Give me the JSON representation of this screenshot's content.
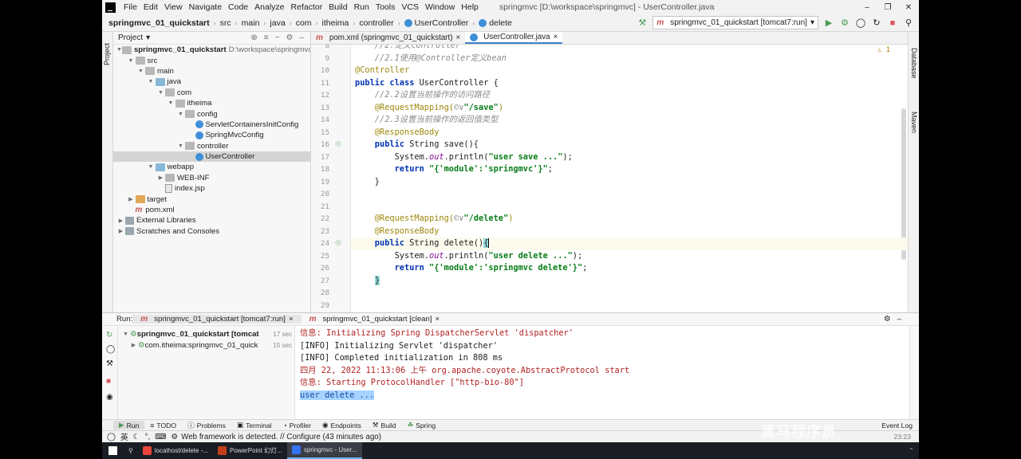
{
  "window": {
    "title": "springmvc [D:\\workspace\\springmvc] - UserController.java",
    "controls": [
      "–",
      "❐",
      "✕"
    ]
  },
  "menu": [
    "File",
    "Edit",
    "View",
    "Navigate",
    "Code",
    "Analyze",
    "Refactor",
    "Build",
    "Run",
    "Tools",
    "VCS",
    "Window",
    "Help"
  ],
  "breadcrumb": [
    "springmvc_01_quickstart",
    "src",
    "main",
    "java",
    "com",
    "itheima",
    "controller",
    "UserController",
    "delete"
  ],
  "run_config": "springmvc_01_quickstart [tomcat7:run]",
  "left_strip": [
    "Project"
  ],
  "right_strip": [
    "Database",
    "Maven"
  ],
  "project_panel": {
    "title": "Project",
    "tree": [
      {
        "label": "springmvc_01_quickstart",
        "path": "D:\\workspace\\springmvc\\s",
        "depth": 0,
        "arrow": "down",
        "icon": "folder-plain",
        "bold": true
      },
      {
        "label": "src",
        "depth": 1,
        "arrow": "down",
        "icon": "folder-plain"
      },
      {
        "label": "main",
        "depth": 2,
        "arrow": "down",
        "icon": "folder-plain"
      },
      {
        "label": "java",
        "depth": 3,
        "arrow": "down",
        "icon": "folder"
      },
      {
        "label": "com",
        "depth": 4,
        "arrow": "down",
        "icon": "folder-plain"
      },
      {
        "label": "itheima",
        "depth": 5,
        "arrow": "down",
        "icon": "folder-plain"
      },
      {
        "label": "config",
        "depth": 6,
        "arrow": "down",
        "icon": "folder-plain"
      },
      {
        "label": "ServletContainersInitConfig",
        "depth": 7,
        "arrow": "",
        "icon": "class"
      },
      {
        "label": "SpringMvcConfig",
        "depth": 7,
        "arrow": "",
        "icon": "class"
      },
      {
        "label": "controller",
        "depth": 6,
        "arrow": "down",
        "icon": "folder-plain"
      },
      {
        "label": "UserController",
        "depth": 7,
        "arrow": "",
        "icon": "class",
        "selected": true
      },
      {
        "label": "webapp",
        "depth": 3,
        "arrow": "down",
        "icon": "folder"
      },
      {
        "label": "WEB-INF",
        "depth": 4,
        "arrow": "right",
        "icon": "folder-plain"
      },
      {
        "label": "index.jsp",
        "depth": 4,
        "arrow": "",
        "icon": "file"
      },
      {
        "label": "target",
        "depth": 1,
        "arrow": "right",
        "icon": "folder-orange"
      },
      {
        "label": "pom.xml",
        "depth": 1,
        "arrow": "",
        "icon": "maven"
      },
      {
        "label": "External Libraries",
        "depth": 0,
        "arrow": "right",
        "icon": "lib"
      },
      {
        "label": "Scratches and Consoles",
        "depth": 0,
        "arrow": "right",
        "icon": "scratch"
      }
    ]
  },
  "editor": {
    "tabs": [
      {
        "label": "pom.xml (springmvc_01_quickstart)",
        "icon": "m",
        "active": false
      },
      {
        "label": "UserController.java",
        "icon": "class",
        "active": true
      }
    ],
    "warnings": "⚠ 1",
    "current_line": 23,
    "lines": [
      {
        "n": 8,
        "tokens": [
          {
            "t": "    //2.定义controller",
            "c": "cmt"
          }
        ]
      },
      {
        "n": 9,
        "tokens": [
          {
            "t": "    //2.1使用@Controller定义bean",
            "c": "cmt"
          }
        ]
      },
      {
        "n": 10,
        "tokens": [
          {
            "t": "@Controller",
            "c": "ann"
          }
        ]
      },
      {
        "n": 11,
        "tokens": [
          {
            "t": "public class ",
            "c": "kw"
          },
          {
            "t": "UserController {",
            "c": ""
          }
        ]
      },
      {
        "n": 12,
        "tokens": [
          {
            "t": "    //2.2设置当前操作的访问路径",
            "c": "cmt"
          }
        ]
      },
      {
        "n": 13,
        "tokens": [
          {
            "t": "    @RequestMapping(",
            "c": "ann"
          },
          {
            "t": "©∨",
            "c": "cmt"
          },
          {
            "t": "\"/save\"",
            "c": "str"
          },
          {
            "t": ")",
            "c": "ann"
          }
        ]
      },
      {
        "n": 14,
        "tokens": [
          {
            "t": "    //2.3设置当前操作的返回值类型",
            "c": "cmt"
          }
        ]
      },
      {
        "n": 15,
        "tokens": [
          {
            "t": "    @ResponseBody",
            "c": "ann"
          }
        ]
      },
      {
        "n": 16,
        "tokens": [
          {
            "t": "    public ",
            "c": "kw"
          },
          {
            "t": "String save(){",
            "c": ""
          }
        ]
      },
      {
        "n": 17,
        "tokens": [
          {
            "t": "        System.",
            "c": ""
          },
          {
            "t": "out",
            "c": "fld"
          },
          {
            "t": ".println(",
            "c": ""
          },
          {
            "t": "\"user save ...\"",
            "c": "str"
          },
          {
            "t": ");",
            "c": ""
          }
        ]
      },
      {
        "n": 18,
        "tokens": [
          {
            "t": "        return ",
            "c": "kw"
          },
          {
            "t": "\"{'module':'springmvc'}\"",
            "c": "str"
          },
          {
            "t": ";",
            "c": ""
          }
        ]
      },
      {
        "n": 19,
        "tokens": [
          {
            "t": "    }",
            "c": ""
          }
        ]
      },
      {
        "n": 20,
        "tokens": []
      },
      {
        "n": 21,
        "tokens": []
      },
      {
        "n": 22,
        "tokens": [
          {
            "t": "    @RequestMapping(",
            "c": "ann"
          },
          {
            "t": "©∨",
            "c": "cmt"
          },
          {
            "t": "\"/delete\"",
            "c": "str"
          },
          {
            "t": ")",
            "c": "ann"
          }
        ]
      },
      {
        "n": 23,
        "tokens": [
          {
            "t": "    @ResponseBody",
            "c": "ann"
          }
        ]
      },
      {
        "n": 24,
        "tokens": [
          {
            "t": "    public ",
            "c": "kw"
          },
          {
            "t": "String delete()",
            "c": ""
          },
          {
            "t": "{",
            "c": "brace"
          }
        ]
      },
      {
        "n": 25,
        "tokens": [
          {
            "t": "        System.",
            "c": ""
          },
          {
            "t": "out",
            "c": "fld"
          },
          {
            "t": ".println(",
            "c": ""
          },
          {
            "t": "\"user delete ...\"",
            "c": "str"
          },
          {
            "t": ");",
            "c": ""
          }
        ]
      },
      {
        "n": 26,
        "tokens": [
          {
            "t": "        return ",
            "c": "kw"
          },
          {
            "t": "\"{'module':'springmvc delete'}\"",
            "c": "str"
          },
          {
            "t": ";",
            "c": ""
          }
        ]
      },
      {
        "n": 27,
        "tokens": [
          {
            "t": "    ",
            "c": ""
          },
          {
            "t": "}",
            "c": "brace"
          }
        ]
      },
      {
        "n": 28,
        "tokens": []
      },
      {
        "n": 29,
        "tokens": []
      }
    ],
    "line_numbers": [
      8,
      9,
      10,
      11,
      12,
      13,
      14,
      15,
      16,
      17,
      18,
      19,
      20,
      21,
      22,
      23,
      24,
      25,
      26,
      27,
      28,
      29
    ]
  },
  "run_panel": {
    "label": "Run:",
    "tabs": [
      {
        "label": "springmvc_01_quickstart [tomcat7:run]",
        "active": true
      },
      {
        "label": "springmvc_01_quickstart [clean]",
        "active": false
      }
    ],
    "tree": [
      {
        "label": "springmvc_01_quickstart [tomcat",
        "duration": "17 sec",
        "bold": true
      },
      {
        "label": "com.itheima:springmvc_01_quick",
        "duration": "15 sec",
        "bold": false
      }
    ],
    "side_tabs": [
      "Structure",
      "Favorites"
    ],
    "console": [
      {
        "text": "信息: Initializing Spring DispatcherServlet 'dispatcher'",
        "red": true
      },
      {
        "text": "[INFO] Initializing Servlet 'dispatcher'",
        "red": false
      },
      {
        "text": "[INFO] Completed initialization in 808 ms",
        "red": false
      },
      {
        "text": "四月 22, 2022 11:13:06 上午 org.apache.coyote.AbstractProtocol start",
        "red": true
      },
      {
        "text": "信息: Starting ProtocolHandler [\"http-bio-80\"]",
        "red": true
      },
      {
        "text": "user delete ...",
        "red": false,
        "selected": true
      }
    ]
  },
  "tool_tabs": [
    "Run",
    "TODO",
    "Problems",
    "Terminal",
    "Profiler",
    "Endpoints",
    "Build",
    "Spring"
  ],
  "event_log": "Event Log",
  "status": {
    "ime": "英",
    "message": "Web framework is detected. // Configure (43 minutes ago)",
    "time": "23:23"
  },
  "taskbar": [
    {
      "label": "localhost/delete -...",
      "color": "#e8453c",
      "active": false
    },
    {
      "label": "PowerPoint 幻灯...",
      "color": "#c43e1c",
      "active": false
    },
    {
      "label": "springmvc - User...",
      "color": "#3574f0",
      "active": true
    }
  ],
  "watermark": "黑马程序员"
}
